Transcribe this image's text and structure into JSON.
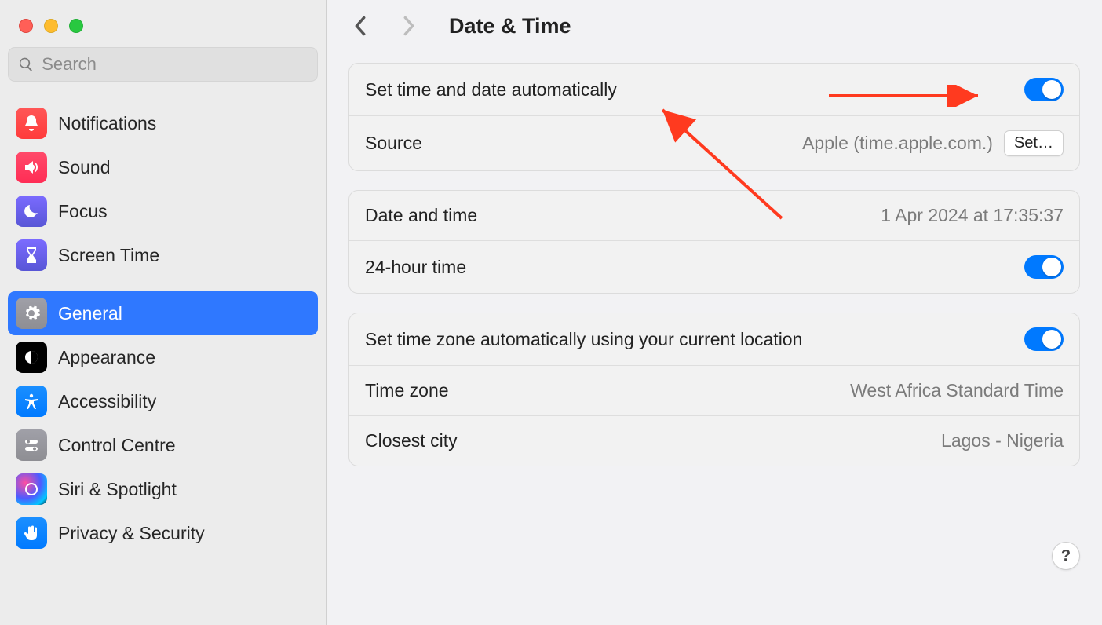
{
  "header": {
    "title": "Date & Time"
  },
  "search": {
    "placeholder": "Search"
  },
  "sidebar": {
    "group1": [
      {
        "key": "notifications",
        "label": "Notifications"
      },
      {
        "key": "sound",
        "label": "Sound"
      },
      {
        "key": "focus",
        "label": "Focus"
      },
      {
        "key": "screentime",
        "label": "Screen Time"
      }
    ],
    "group2": [
      {
        "key": "general",
        "label": "General",
        "selected": true
      },
      {
        "key": "appearance",
        "label": "Appearance"
      },
      {
        "key": "accessibility",
        "label": "Accessibility"
      },
      {
        "key": "controlcentre",
        "label": "Control Centre"
      },
      {
        "key": "siri",
        "label": "Siri & Spotlight"
      },
      {
        "key": "privacy",
        "label": "Privacy & Security"
      }
    ]
  },
  "rows": {
    "auto_time": {
      "label": "Set time and date automatically",
      "on": true
    },
    "source": {
      "label": "Source",
      "value": "Apple (time.apple.com.)",
      "button": "Set…"
    },
    "datetime": {
      "label": "Date and time",
      "value": "1 Apr 2024 at 17:35:37"
    },
    "h24": {
      "label": "24-hour time",
      "on": true
    },
    "auto_tz": {
      "label": "Set time zone automatically using your current location",
      "on": true
    },
    "tz": {
      "label": "Time zone",
      "value": "West Africa Standard Time"
    },
    "city": {
      "label": "Closest city",
      "value": "Lagos - Nigeria"
    }
  },
  "help": "?",
  "colors": {
    "accent": "#0079ff",
    "annotation": "#ff3a1f"
  }
}
